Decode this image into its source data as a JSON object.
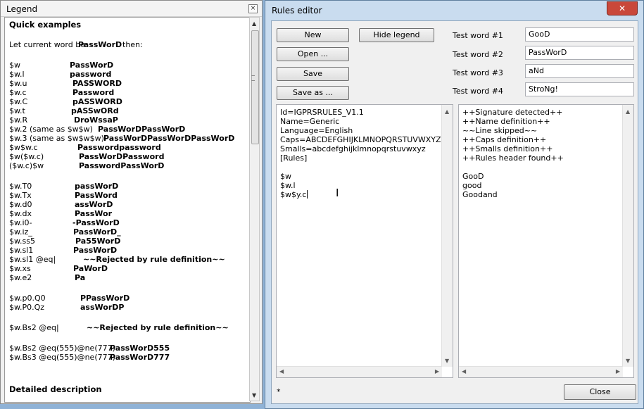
{
  "legend": {
    "title": "Legend",
    "close_glyph": "×",
    "heading": "Quick examples",
    "intro_prefix": "Let current word be",
    "intro_word": "PassWorD",
    "intro_suffix": "then:",
    "examples": [
      {
        "rule": "$w",
        "result": "PassWorD"
      },
      {
        "rule": "$w.l",
        "result": "password"
      },
      {
        "rule": "$w.u",
        "result": "PASSWORD"
      },
      {
        "rule": "$w.c",
        "result": "Password"
      },
      {
        "rule": "$w.C",
        "result": "pASSWORD"
      },
      {
        "rule": "$w.t",
        "result": "pASSwORd"
      },
      {
        "rule": "$w.R",
        "result": "DroWssaP"
      },
      {
        "rule": "$w.2 (same as $w$w)",
        "result": "PassWorDPassWorD"
      },
      {
        "rule": "$w.3 (same as $w$w$w)",
        "result": "PassWorDPassWorDPassWorD"
      },
      {
        "rule": "$w$w.c",
        "result": "Passwordpassword"
      },
      {
        "rule": "$w($w.c)",
        "result": "PassWorDPassword"
      },
      {
        "rule": "($w.c)$w",
        "result": "PasswordPassWorD"
      }
    ],
    "examples2": [
      {
        "rule": "$w.T0",
        "result": "passWorD"
      },
      {
        "rule": "$w.Tx",
        "result": "PassWord"
      },
      {
        "rule": "$w.d0",
        "result": "assWorD"
      },
      {
        "rule": "$w.dx",
        "result": "PassWor"
      },
      {
        "rule": "$w.i0-",
        "result": "-PassWorD"
      },
      {
        "rule": "$w.iz_",
        "result": "PassWorD_"
      },
      {
        "rule": "$w.ss5",
        "result": "Pa55WorD"
      },
      {
        "rule": "$w.sl1",
        "result": "PassWorD"
      },
      {
        "rule": "$w.sl1 @eq|",
        "result": "~~Rejected by rule definition~~"
      },
      {
        "rule": "$w.xs",
        "result": "PaWorD"
      },
      {
        "rule": "$w.e2",
        "result": "Pa"
      }
    ],
    "examples3": [
      {
        "rule": "$w.p0.Q0",
        "result": "PPassWorD"
      },
      {
        "rule": "$w.P0.Qz",
        "result": "assWorDP"
      }
    ],
    "examples4": [
      {
        "rule": "$w.Bs2 @eq|",
        "result": "~~Rejected by rule definition~~"
      }
    ],
    "examples5": [
      {
        "rule": "$w.Bs2 @eq(555)@ne(777)",
        "result": "PassWorD555"
      },
      {
        "rule": "$w.Bs3 @eq(555)@ne(777)",
        "result": "PassWorD777"
      }
    ],
    "detail_heading": "Detailed description"
  },
  "rules_editor": {
    "title": "Rules editor",
    "close_glyph": "✕",
    "buttons": {
      "new": "New",
      "hide_legend": "Hide legend",
      "open": "Open ...",
      "save": "Save",
      "save_as": "Save as ...",
      "close": "Close"
    },
    "test_words": [
      {
        "label": "Test word #1",
        "value": "GooD"
      },
      {
        "label": "Test word #2",
        "value": "PassWorD"
      },
      {
        "label": "Test word #3",
        "value": "aNd"
      },
      {
        "label": "Test word #4",
        "value": "StroNg!"
      }
    ],
    "editor_lines": [
      "Id=IGPRSRULES_V1.1",
      "Name=Generic",
      "Language=English",
      "Caps=ABCDEFGHIJKLMNOPQRSTUVWXYZ",
      "Smalls=abcdefghijklmnopqrstuvwxyz",
      "[Rules]",
      "",
      "$w",
      "$w.l",
      "$w$y.c"
    ],
    "output_lines": [
      "++Signature detected++",
      "++Name definition++",
      "~~Line skipped~~",
      "++Caps definition++",
      "++Smalls definition++",
      "++Rules header found++",
      "",
      "GooD",
      "good",
      "Goodand"
    ],
    "status": "*"
  }
}
